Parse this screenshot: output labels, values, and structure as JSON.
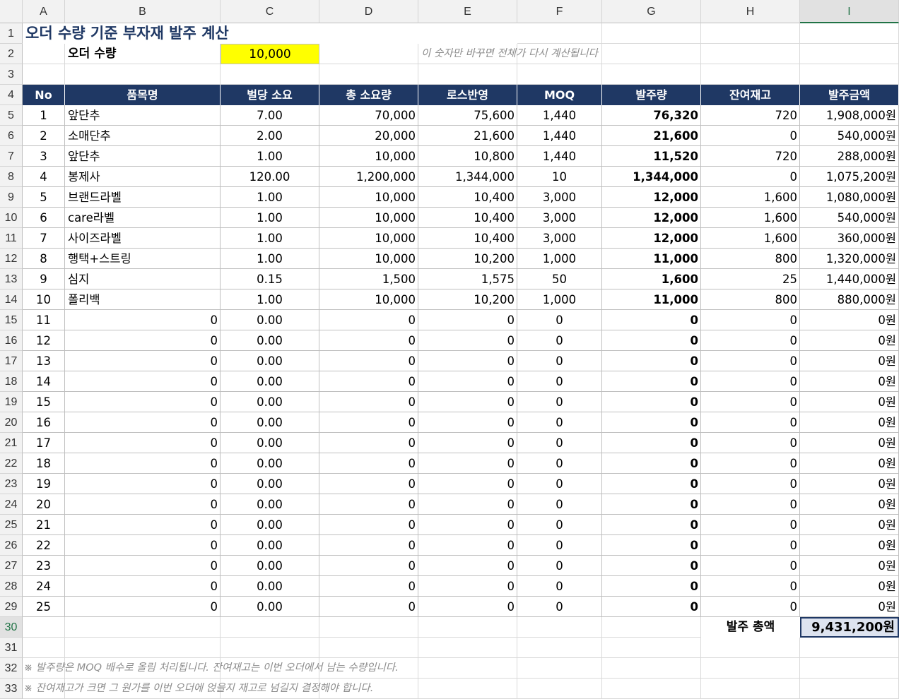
{
  "columns": [
    "A",
    "B",
    "C",
    "D",
    "E",
    "F",
    "G",
    "H",
    "I"
  ],
  "selected_column": "I",
  "selected_row": "30",
  "title": "오더 수량 기준 부자재 발주 계산",
  "order": {
    "label": "오더 수량",
    "value": "10,000",
    "hint": "이 숫자만 바꾸면 전체가 다시 계산됩니다"
  },
  "table": {
    "headers": [
      "No",
      "품목명",
      "벌당 소요",
      "총 소요량",
      "로스반영",
      "MOQ",
      "발주량",
      "잔여재고",
      "발주금액"
    ],
    "rows": [
      [
        "1",
        "앞단추",
        "7.00",
        "70,000",
        "75,600",
        "1,440",
        "76,320",
        "720",
        "1,908,000원"
      ],
      [
        "2",
        "소매단추",
        "2.00",
        "20,000",
        "21,600",
        "1,440",
        "21,600",
        "0",
        "540,000원"
      ],
      [
        "3",
        "앞단추",
        "1.00",
        "10,000",
        "10,800",
        "1,440",
        "11,520",
        "720",
        "288,000원"
      ],
      [
        "4",
        "봉제사",
        "120.00",
        "1,200,000",
        "1,344,000",
        "10",
        "1,344,000",
        "0",
        "1,075,200원"
      ],
      [
        "5",
        "브랜드라벨",
        "1.00",
        "10,000",
        "10,400",
        "3,000",
        "12,000",
        "1,600",
        "1,080,000원"
      ],
      [
        "6",
        "care라벨",
        "1.00",
        "10,000",
        "10,400",
        "3,000",
        "12,000",
        "1,600",
        "540,000원"
      ],
      [
        "7",
        "사이즈라벨",
        "1.00",
        "10,000",
        "10,400",
        "3,000",
        "12,000",
        "1,600",
        "360,000원"
      ],
      [
        "8",
        "행택+스트링",
        "1.00",
        "10,000",
        "10,200",
        "1,000",
        "11,000",
        "800",
        "1,320,000원"
      ],
      [
        "9",
        "심지",
        "0.15",
        "1,500",
        "1,575",
        "50",
        "1,600",
        "25",
        "1,440,000원"
      ],
      [
        "10",
        "폴리백",
        "1.00",
        "10,000",
        "10,200",
        "1,000",
        "11,000",
        "800",
        "880,000원"
      ],
      [
        "11",
        "0",
        "0.00",
        "0",
        "0",
        "0",
        "0",
        "0",
        "0원"
      ],
      [
        "12",
        "0",
        "0.00",
        "0",
        "0",
        "0",
        "0",
        "0",
        "0원"
      ],
      [
        "13",
        "0",
        "0.00",
        "0",
        "0",
        "0",
        "0",
        "0",
        "0원"
      ],
      [
        "14",
        "0",
        "0.00",
        "0",
        "0",
        "0",
        "0",
        "0",
        "0원"
      ],
      [
        "15",
        "0",
        "0.00",
        "0",
        "0",
        "0",
        "0",
        "0",
        "0원"
      ],
      [
        "16",
        "0",
        "0.00",
        "0",
        "0",
        "0",
        "0",
        "0",
        "0원"
      ],
      [
        "17",
        "0",
        "0.00",
        "0",
        "0",
        "0",
        "0",
        "0",
        "0원"
      ],
      [
        "18",
        "0",
        "0.00",
        "0",
        "0",
        "0",
        "0",
        "0",
        "0원"
      ],
      [
        "19",
        "0",
        "0.00",
        "0",
        "0",
        "0",
        "0",
        "0",
        "0원"
      ],
      [
        "20",
        "0",
        "0.00",
        "0",
        "0",
        "0",
        "0",
        "0",
        "0원"
      ],
      [
        "21",
        "0",
        "0.00",
        "0",
        "0",
        "0",
        "0",
        "0",
        "0원"
      ],
      [
        "22",
        "0",
        "0.00",
        "0",
        "0",
        "0",
        "0",
        "0",
        "0원"
      ],
      [
        "23",
        "0",
        "0.00",
        "0",
        "0",
        "0",
        "0",
        "0",
        "0원"
      ],
      [
        "24",
        "0",
        "0.00",
        "0",
        "0",
        "0",
        "0",
        "0",
        "0원"
      ],
      [
        "25",
        "0",
        "0.00",
        "0",
        "0",
        "0",
        "0",
        "0",
        "0원"
      ]
    ]
  },
  "total": {
    "label": "발주 총액",
    "value": "9,431,200원"
  },
  "notes": [
    "※ 발주량은 MOQ 배수로 올림 처리됩니다. 잔여재고는 이번 오더에서 남는 수량입니다.",
    "※ 잔여재고가 크면 그 원가를 이번 오더에 얹을지 재고로 넘길지 결정해야 합니다."
  ],
  "colors": {
    "header_bg": "#1f3864",
    "input_bg": "#ffff00",
    "selection": "#217346"
  }
}
